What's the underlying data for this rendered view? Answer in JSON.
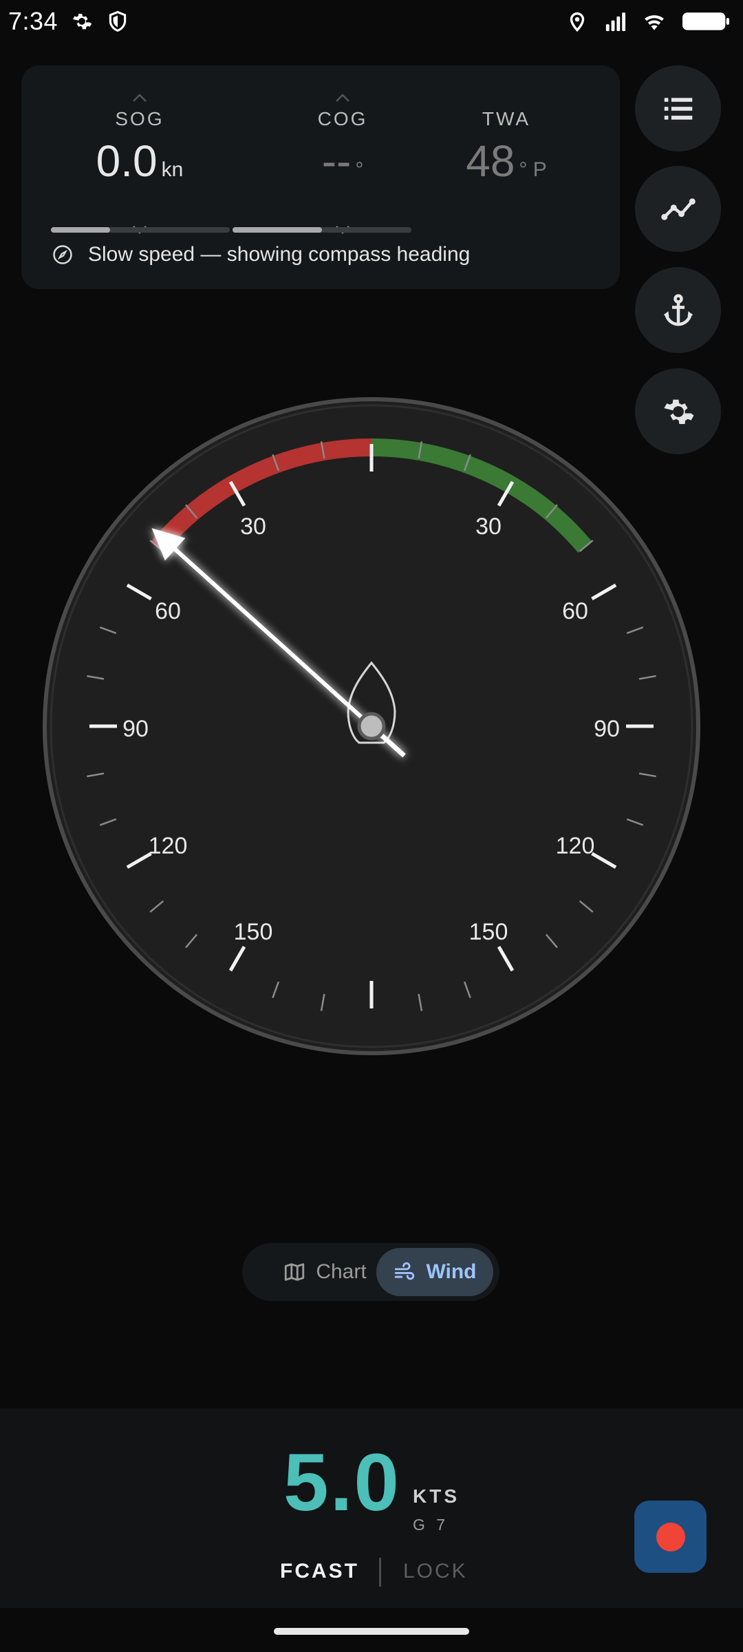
{
  "status_bar": {
    "time": "7:34",
    "icons": [
      "settings-icon",
      "shield-icon",
      "location-icon",
      "signal-icon",
      "wifi-icon",
      "battery-icon"
    ]
  },
  "info": {
    "sog": {
      "label": "SOG",
      "value": "0.0",
      "unit": "kn",
      "bar_fraction": 0.33
    },
    "cog": {
      "label": "COG",
      "value": "--",
      "unit": "°",
      "bar_fraction": 0.5
    },
    "twa": {
      "label": "TWA",
      "value": "48",
      "unit": "° P"
    },
    "notice": "Slow speed — showing compass heading"
  },
  "side_buttons": [
    "list-icon",
    "trend-icon",
    "anchor-icon",
    "gear-icon"
  ],
  "gauge": {
    "labels_left": [
      "30",
      "60",
      "90",
      "120",
      "150"
    ],
    "labels_right": [
      "30",
      "60",
      "90",
      "120",
      "150"
    ],
    "needle_angle_deg": -48,
    "red_arc_deg": [
      0,
      50
    ],
    "green_arc_deg": [
      0,
      50
    ],
    "colors": {
      "red": "#b53330",
      "green": "#3a7a35",
      "ring": "#4a4a4a",
      "face": "#1f1f1f"
    }
  },
  "mode_toggle": {
    "chart_label": "Chart",
    "wind_label": "Wind",
    "selected": "Wind"
  },
  "bottom": {
    "speed_value": "5.0",
    "speed_unit": "KTS",
    "speed_sub": "G 7",
    "fcast_label": "FCAST",
    "lock_label": "LOCK",
    "accent": "#4bbfb8"
  }
}
